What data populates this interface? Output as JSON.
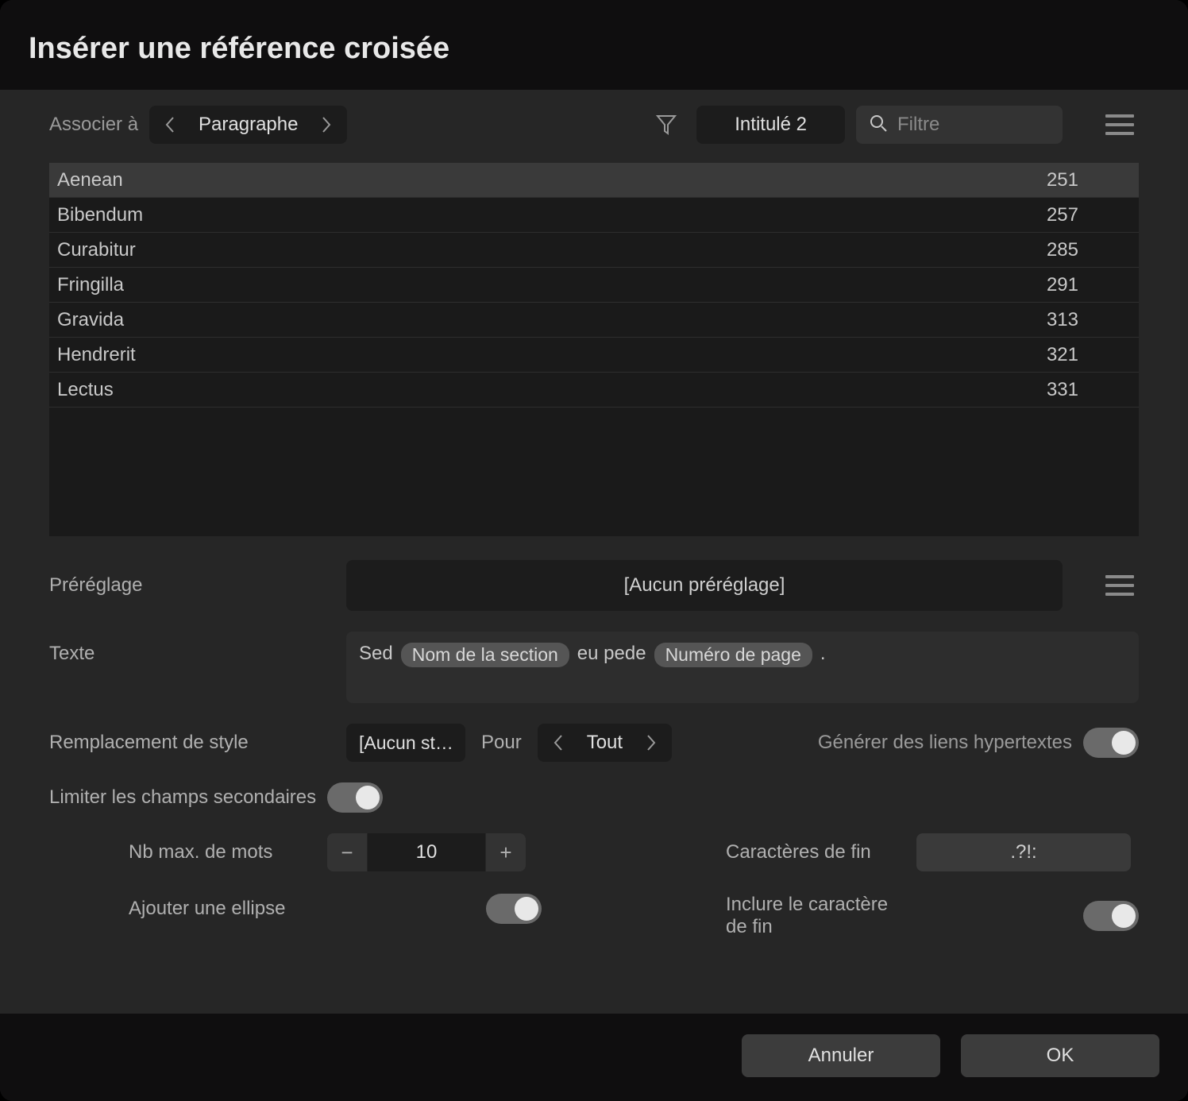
{
  "title": "Insérer une référence croisée",
  "toolbar": {
    "link_to_label": "Associer à",
    "selector_value": "Paragraphe",
    "tag_value": "Intitulé 2",
    "search_placeholder": "Filtre"
  },
  "list": [
    {
      "name": "Aenean",
      "page": "251",
      "selected": true
    },
    {
      "name": "Bibendum",
      "page": "257",
      "selected": false
    },
    {
      "name": "Curabitur",
      "page": "285",
      "selected": false
    },
    {
      "name": "Fringilla",
      "page": "291",
      "selected": false
    },
    {
      "name": "Gravida",
      "page": "313",
      "selected": false
    },
    {
      "name": "Hendrerit",
      "page": "321",
      "selected": false
    },
    {
      "name": "Lectus",
      "page": "331",
      "selected": false
    }
  ],
  "preset": {
    "label": "Préréglage",
    "value": "[Aucun préréglage]"
  },
  "text": {
    "label": "Texte",
    "parts": [
      {
        "type": "text",
        "value": "Sed"
      },
      {
        "type": "token",
        "value": "Nom de la section"
      },
      {
        "type": "text",
        "value": "eu pede"
      },
      {
        "type": "token",
        "value": "Numéro de page"
      },
      {
        "type": "text",
        "value": "."
      }
    ]
  },
  "style": {
    "label": "Remplacement de style",
    "value": "[Aucun st…",
    "pour_label": "Pour",
    "pour_value": "Tout"
  },
  "hyperlinks": {
    "label": "Générer des liens hypertextes",
    "value": true
  },
  "limit": {
    "label": "Limiter les champs secondaires",
    "value": true
  },
  "max_words": {
    "label": "Nb max. de mots",
    "value": "10"
  },
  "ellipsis": {
    "label": "Ajouter une ellipse",
    "value": true
  },
  "end_chars": {
    "label": "Caractères de fin",
    "value": ".?!:"
  },
  "include_end": {
    "label": "Inclure le caractère de fin",
    "value": true
  },
  "buttons": {
    "cancel": "Annuler",
    "ok": "OK"
  }
}
